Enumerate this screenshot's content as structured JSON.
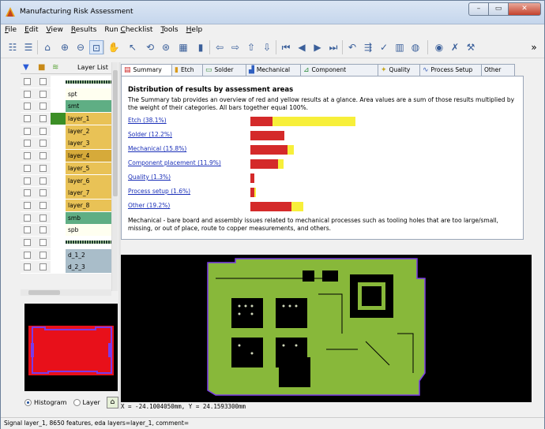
{
  "window": {
    "title": "Manufacturing Risk Assessment",
    "controls": [
      "minimize",
      "maximize",
      "close"
    ]
  },
  "menu": [
    {
      "label": "File"
    },
    {
      "label": "Edit"
    },
    {
      "label": "View"
    },
    {
      "label": "Results"
    },
    {
      "label": "Run Checklist"
    },
    {
      "label": "Tools"
    },
    {
      "label": "Help"
    }
  ],
  "toolbar": {
    "icons": [
      "layers-icon",
      "list-icon",
      "home-icon",
      "zoom-in-icon",
      "zoom-out-icon",
      "zoom-select-icon",
      "pan-icon",
      "pointer-icon",
      "measure-icon",
      "binoculars-icon",
      "grid-icon",
      "chart-icon",
      "arrow-left-icon",
      "arrow-right-icon",
      "arrow-up-icon",
      "arrow-down-icon",
      "first-icon",
      "prev-icon",
      "next-icon",
      "last-icon",
      "undo-icon",
      "split-icon",
      "check-icon",
      "bars-icon",
      "drop-icon",
      "eye-icon",
      "close-x-icon",
      "tools-icon"
    ],
    "overflow": "»"
  },
  "layers": {
    "header": "Layer List",
    "rows": [
      {
        "name": "",
        "color": "#ffffff",
        "name_bg": "#1e3b2e",
        "pattern": true
      },
      {
        "name": "spt",
        "color": "#ffffff",
        "name_bg": "#fffff0"
      },
      {
        "name": "smt",
        "color": "#ffffff",
        "name_bg": "#5fae84"
      },
      {
        "name": "layer_1",
        "color": "#3c8f26",
        "name_bg": "#e9c256"
      },
      {
        "name": "layer_2",
        "color": "#ffffff",
        "name_bg": "#e9c256"
      },
      {
        "name": "layer_3",
        "color": "#ffffff",
        "name_bg": "#e9c256"
      },
      {
        "name": "layer_4",
        "color": "#ffffff",
        "name_bg": "#d6aa3a"
      },
      {
        "name": "layer_5",
        "color": "#ffffff",
        "name_bg": "#e9c256"
      },
      {
        "name": "layer_6",
        "color": "#ffffff",
        "name_bg": "#e9c256"
      },
      {
        "name": "layer_7",
        "color": "#ffffff",
        "name_bg": "#e9c256"
      },
      {
        "name": "layer_8",
        "color": "#ffffff",
        "name_bg": "#e9c256"
      },
      {
        "name": "smb",
        "color": "#ffffff",
        "name_bg": "#5fae84"
      },
      {
        "name": "spb",
        "color": "#ffffff",
        "name_bg": "#fffff0"
      },
      {
        "name": "",
        "color": "#ffffff",
        "name_bg": "#1e3b2e",
        "pattern": true
      },
      {
        "name": "d_1_2",
        "color": "#ffffff",
        "name_bg": "#a9bdc9"
      },
      {
        "name": "d_2_3",
        "color": "#ffffff",
        "name_bg": "#a9bdc9"
      }
    ],
    "view_options": {
      "histogram": "Histogram",
      "layer": "Layer",
      "selected": "histogram"
    }
  },
  "tabs": [
    {
      "label": "Summary",
      "icon": "summary-icon",
      "active": true
    },
    {
      "label": "Etch",
      "icon": "etch-icon"
    },
    {
      "label": "Solder",
      "icon": "solder-icon"
    },
    {
      "label": "Mechanical",
      "icon": "mechanical-icon"
    },
    {
      "label": "Component Placement",
      "icon": "placement-icon"
    },
    {
      "label": "Quality",
      "icon": "quality-icon"
    },
    {
      "label": "Process Setup",
      "icon": "process-icon"
    },
    {
      "label": "Other",
      "icon": ""
    }
  ],
  "summary": {
    "title": "Distribution of results by assessment areas",
    "description": "The Summary tab provides an overview of red and yellow results at a glance.   Area values are a sum of those results multiplied by the weight of their categories.   All bars together equal 100%.",
    "footnote": "Mechanical - bare board and assembly issues related to mechanical processes such as tooling holes that are too large/small, missing, or out of place, route to copper measurements, and others."
  },
  "chart_data": {
    "type": "bar",
    "categories": [
      "Etch (38.1%)",
      "Solder (12.2%)",
      "Mechanical (15.8%)",
      "Component placement (11.9%)",
      "Quality (1.3%)",
      "Process setup (1.6%)",
      "Other (19.2%)"
    ],
    "series": [
      {
        "name": "red",
        "color": "#d42a2a",
        "values": [
          8.0,
          12.2,
          13.5,
          10.0,
          1.3,
          1.3,
          15.0
        ]
      },
      {
        "name": "yellow",
        "color": "#f7ef3a",
        "values": [
          30.1,
          0,
          2.3,
          1.9,
          0,
          0.3,
          4.2
        ]
      }
    ],
    "xlim": [
      0,
      38.1
    ]
  },
  "viewer": {
    "coordinates": "X = -24.1004050mm, Y = 24.1593300mm"
  },
  "status": "Signal layer_1, 8650 features, eda layers=layer_1, comment="
}
